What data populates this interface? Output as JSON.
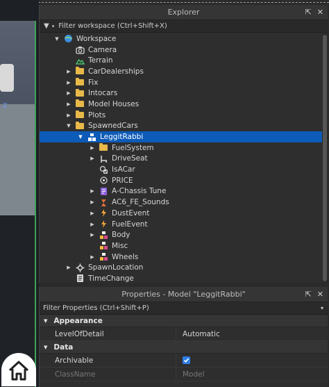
{
  "explorer": {
    "title": "Explorer",
    "filter_placeholder": "Filter workspace (Ctrl+Shift+X)"
  },
  "tree": [
    {
      "label": "Workspace",
      "icon": "workspace-icon",
      "indent": 0,
      "arrow": "down"
    },
    {
      "label": "Camera",
      "icon": "camera-icon",
      "indent": 1,
      "arrow": ""
    },
    {
      "label": "Terrain",
      "icon": "terrain-icon",
      "indent": 1,
      "arrow": ""
    },
    {
      "label": "CarDealerships",
      "icon": "folder-icon",
      "indent": 1,
      "arrow": "right"
    },
    {
      "label": "Fix",
      "icon": "folder-icon",
      "indent": 1,
      "arrow": "right"
    },
    {
      "label": "Intocars",
      "icon": "folder-icon",
      "indent": 1,
      "arrow": "right"
    },
    {
      "label": "Model Houses",
      "icon": "folder-icon",
      "indent": 1,
      "arrow": "right"
    },
    {
      "label": "Plots",
      "icon": "folder-icon",
      "indent": 1,
      "arrow": "right"
    },
    {
      "label": "SpawnedCars",
      "icon": "folder-icon",
      "indent": 1,
      "arrow": "down"
    },
    {
      "label": "LeggitRabbi",
      "icon": "model-icon",
      "indent": 2,
      "arrow": "down",
      "selected": true
    },
    {
      "label": "FuelSystem",
      "icon": "folder-icon",
      "indent": 3,
      "arrow": "right"
    },
    {
      "label": "DriveSeat",
      "icon": "vehicle-seat-icon",
      "indent": 3,
      "arrow": "right"
    },
    {
      "label": "IsACar",
      "icon": "bool-value-icon",
      "indent": 3,
      "arrow": ""
    },
    {
      "label": "PRICE",
      "icon": "number-value-icon",
      "indent": 3,
      "arrow": ""
    },
    {
      "label": "A-Chassis Tune",
      "icon": "module-script-icon",
      "indent": 3,
      "arrow": "right"
    },
    {
      "label": "AC6_FE_Sounds",
      "icon": "script-icon",
      "indent": 3,
      "arrow": "right"
    },
    {
      "label": "DustEvent",
      "icon": "remote-event-icon",
      "indent": 3,
      "arrow": "right"
    },
    {
      "label": "FuelEvent",
      "icon": "remote-event-icon",
      "indent": 3,
      "arrow": "right"
    },
    {
      "label": "Body",
      "icon": "part-model-icon",
      "indent": 3,
      "arrow": "right"
    },
    {
      "label": "Misc",
      "icon": "part-model-icon",
      "indent": 3,
      "arrow": ""
    },
    {
      "label": "Wheels",
      "icon": "part-model-icon",
      "indent": 3,
      "arrow": "right"
    },
    {
      "label": "SpawnLocation",
      "icon": "spawn-location-icon",
      "indent": 1,
      "arrow": "right"
    },
    {
      "label": "TimeChange",
      "icon": "script-doc-icon",
      "indent": 1,
      "arrow": ""
    }
  ],
  "properties": {
    "title": "Properties - Model \"LeggitRabbi\"",
    "filter_placeholder": "Filter Properties (Ctrl+Shift+P)",
    "sections": [
      {
        "name": "Appearance",
        "rows": [
          {
            "name": "LevelOfDetail",
            "value": "Automatic"
          }
        ]
      },
      {
        "name": "Data",
        "rows": [
          {
            "name": "Archivable",
            "value": "checked"
          },
          {
            "name": "ClassName",
            "value": "Model"
          }
        ]
      }
    ]
  },
  "colors": {
    "selection": "#0d5bb8",
    "folder": "#e8b949",
    "accent_border": "#3ea35a"
  }
}
